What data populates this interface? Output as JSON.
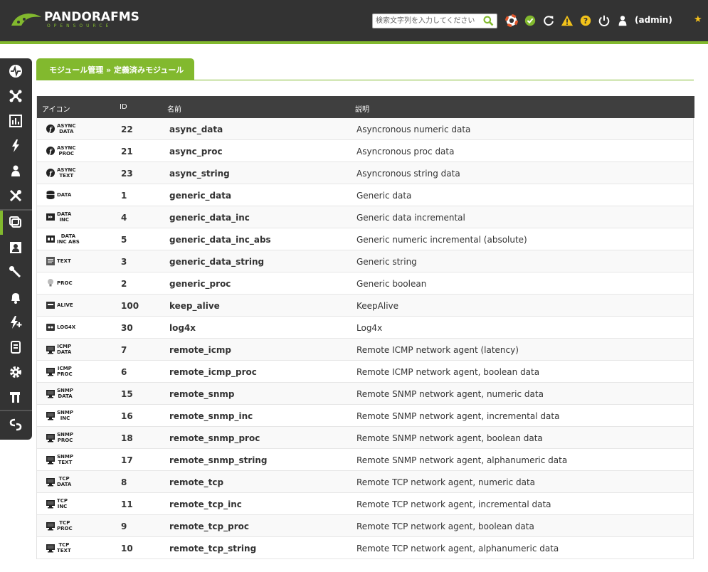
{
  "header": {
    "logo_main": "PANDORAFMS",
    "logo_sub": "OPENSOURCE",
    "search_placeholder": "検索文字列を入力してください",
    "user_label": "(admin)",
    "accent": "#82b92e",
    "bg": "#333333",
    "icons": [
      "help-lifebuoy-icon",
      "ok-check-icon",
      "refresh-icon",
      "warning-icon",
      "question-icon",
      "power-icon",
      "user-icon"
    ]
  },
  "sidebar": {
    "items": [
      {
        "name": "monitoring",
        "icon": "pulse-icon"
      },
      {
        "name": "topology",
        "icon": "network-icon"
      },
      {
        "name": "reporting",
        "icon": "report-icon"
      },
      {
        "name": "events",
        "icon": "bolt-icon"
      },
      {
        "name": "workspace",
        "icon": "user-icon"
      },
      {
        "name": "tools",
        "icon": "tools-icon"
      },
      {
        "name": "resources",
        "icon": "module-icon"
      },
      {
        "name": "profiles",
        "icon": "profile-icon"
      },
      {
        "name": "configuration",
        "icon": "wrench-icon"
      },
      {
        "name": "alerts",
        "icon": "bell-icon"
      },
      {
        "name": "servers",
        "icon": "bolt-plus-icon"
      },
      {
        "name": "setup",
        "icon": "server-icon"
      },
      {
        "name": "admin-tools",
        "icon": "gear-icon"
      },
      {
        "name": "extensions",
        "icon": "hammer-icon"
      },
      {
        "name": "links",
        "icon": "link-icon"
      }
    ]
  },
  "page": {
    "title": "モジュール管理 » 定義済みモジュール"
  },
  "table": {
    "headers": {
      "icon": "アイコン",
      "id": "ID",
      "name": "名前",
      "desc": "説明"
    },
    "rows": [
      {
        "icon": "async-icon",
        "tag": "ASYNC\nDATA",
        "id": "22",
        "name": "async_data",
        "desc": "Asyncronous numeric data"
      },
      {
        "icon": "async-icon",
        "tag": "ASYNC\nPROC",
        "id": "21",
        "name": "async_proc",
        "desc": "Asyncronous proc data"
      },
      {
        "icon": "async-icon",
        "tag": "ASYNC\nTEXT",
        "id": "23",
        "name": "async_string",
        "desc": "Asyncronous string data"
      },
      {
        "icon": "database-icon",
        "tag": "DATA",
        "id": "1",
        "name": "generic_data",
        "desc": "Generic data"
      },
      {
        "icon": "data-inc-icon",
        "tag": "DATA\nINC",
        "id": "4",
        "name": "generic_data_inc",
        "desc": "Generic data incremental"
      },
      {
        "icon": "data-inc-abs-icon",
        "tag": "DATA\nINC ABS",
        "id": "5",
        "name": "generic_data_inc_abs",
        "desc": "Generic numeric incremental (absolute)"
      },
      {
        "icon": "text-icon",
        "tag": "TEXT",
        "id": "3",
        "name": "generic_data_string",
        "desc": "Generic string"
      },
      {
        "icon": "bulb-icon",
        "tag": "PROC",
        "id": "2",
        "name": "generic_proc",
        "desc": "Generic boolean"
      },
      {
        "icon": "alive-icon",
        "tag": "ALIVE",
        "id": "100",
        "name": "keep_alive",
        "desc": "KeepAlive"
      },
      {
        "icon": "log4x-icon",
        "tag": "LOG4X",
        "id": "30",
        "name": "log4x",
        "desc": "Log4x"
      },
      {
        "icon": "monitor-icon",
        "tag": "ICMP\nDATA",
        "id": "7",
        "name": "remote_icmp",
        "desc": "Remote ICMP network agent (latency)"
      },
      {
        "icon": "monitor-icon",
        "tag": "ICMP\nPROC",
        "id": "6",
        "name": "remote_icmp_proc",
        "desc": "Remote ICMP network agent, boolean data"
      },
      {
        "icon": "monitor-icon",
        "tag": "SNMP\nDATA",
        "id": "15",
        "name": "remote_snmp",
        "desc": "Remote SNMP network agent, numeric data"
      },
      {
        "icon": "monitor-icon",
        "tag": "SNMP\nINC",
        "id": "16",
        "name": "remote_snmp_inc",
        "desc": "Remote SNMP network agent, incremental data"
      },
      {
        "icon": "monitor-icon",
        "tag": "SNMP\nPROC",
        "id": "18",
        "name": "remote_snmp_proc",
        "desc": "Remote SNMP network agent, boolean data"
      },
      {
        "icon": "monitor-icon",
        "tag": "SNMP\nTEXT",
        "id": "17",
        "name": "remote_snmp_string",
        "desc": "Remote SNMP network agent, alphanumeric data"
      },
      {
        "icon": "monitor-icon",
        "tag": "TCP\nDATA",
        "id": "8",
        "name": "remote_tcp",
        "desc": "Remote TCP network agent, numeric data"
      },
      {
        "icon": "monitor-icon",
        "tag": "TCP\nINC",
        "id": "11",
        "name": "remote_tcp_inc",
        "desc": "Remote TCP network agent, incremental data"
      },
      {
        "icon": "monitor-icon",
        "tag": "TCP\nPROC",
        "id": "9",
        "name": "remote_tcp_proc",
        "desc": "Remote TCP network agent, boolean data"
      },
      {
        "icon": "monitor-icon",
        "tag": "TCP\nTEXT",
        "id": "10",
        "name": "remote_tcp_string",
        "desc": "Remote TCP network agent, alphanumeric data"
      }
    ]
  }
}
